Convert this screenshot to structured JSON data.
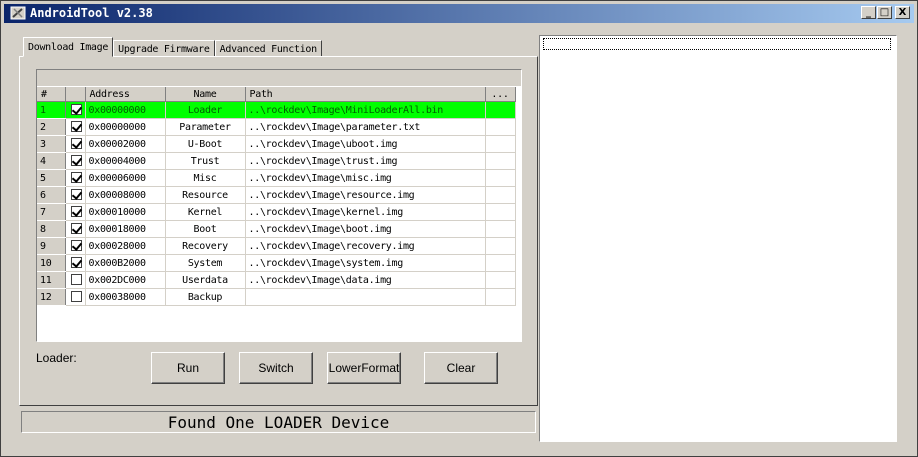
{
  "window": {
    "title": "AndroidTool v2.38",
    "min": "_",
    "max": "□",
    "close": "X"
  },
  "tabs": [
    "Download Image",
    "Upgrade Firmware",
    "Advanced Function"
  ],
  "columns": {
    "index": "#",
    "address": "Address",
    "name": "Name",
    "path": "Path",
    "more": "..."
  },
  "rows": [
    {
      "index": "1",
      "checked": true,
      "address": "0x00000000",
      "name": "Loader",
      "path": "..\\rockdev\\Image\\MiniLoaderAll.bin",
      "selected": true
    },
    {
      "index": "2",
      "checked": true,
      "address": "0x00000000",
      "name": "Parameter",
      "path": "..\\rockdev\\Image\\parameter.txt"
    },
    {
      "index": "3",
      "checked": true,
      "address": "0x00002000",
      "name": "U-Boot",
      "path": "..\\rockdev\\Image\\uboot.img"
    },
    {
      "index": "4",
      "checked": true,
      "address": "0x00004000",
      "name": "Trust",
      "path": "..\\rockdev\\Image\\trust.img"
    },
    {
      "index": "5",
      "checked": true,
      "address": "0x00006000",
      "name": "Misc",
      "path": "..\\rockdev\\Image\\misc.img"
    },
    {
      "index": "6",
      "checked": true,
      "address": "0x00008000",
      "name": "Resource",
      "path": "..\\rockdev\\Image\\resource.img"
    },
    {
      "index": "7",
      "checked": true,
      "address": "0x00010000",
      "name": "Kernel",
      "path": "..\\rockdev\\Image\\kernel.img"
    },
    {
      "index": "8",
      "checked": true,
      "address": "0x00018000",
      "name": "Boot",
      "path": "..\\rockdev\\Image\\boot.img"
    },
    {
      "index": "9",
      "checked": true,
      "address": "0x00028000",
      "name": "Recovery",
      "path": "..\\rockdev\\Image\\recovery.img"
    },
    {
      "index": "10",
      "checked": true,
      "address": "0x000B2000",
      "name": "System",
      "path": "..\\rockdev\\Image\\system.img"
    },
    {
      "index": "11",
      "checked": false,
      "address": "0x002DC000",
      "name": "Userdata",
      "path": "..\\rockdev\\Image\\data.img"
    },
    {
      "index": "12",
      "checked": false,
      "address": "0x00038000",
      "name": "Backup",
      "path": ""
    }
  ],
  "loader_label": "Loader:",
  "buttons": {
    "run": "Run",
    "switch": "Switch",
    "lowerformat": "LowerFormat",
    "clear": "Clear"
  },
  "status": "Found One LOADER Device",
  "colors": {
    "selected_row": "#00ff00",
    "titlebar_start": "#0a246a",
    "titlebar_end": "#a6caf0",
    "face": "#d4d0c8"
  }
}
